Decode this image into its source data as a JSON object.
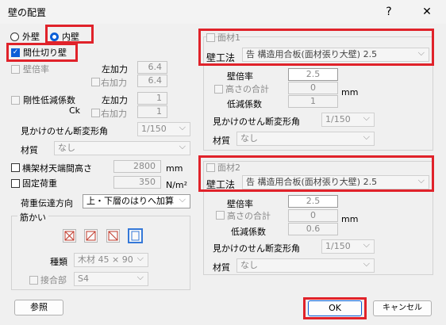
{
  "window": {
    "title": "壁の配置",
    "help": "?",
    "close": "✕"
  },
  "wall_type": {
    "outer": "外壁",
    "inner": "内壁",
    "partition": "間仕切り壁"
  },
  "left": {
    "ratio_label": "壁倍率",
    "left_add": "左加力",
    "right_add": "右加力",
    "ratio_left": "6.4",
    "ratio_right": "6.4",
    "stiff_label": "剛性低減係数",
    "ck": "Ck",
    "stiff_left": "1",
    "stiff_right": "1",
    "shear_angle_label": "見かけのせん断変形角",
    "shear_angle_value": "1/150",
    "material_label": "材質",
    "material_value": "なし",
    "beam_label": "横架材天端間高さ",
    "beam_value": "2800",
    "beam_unit": "mm",
    "fixed_load_label": "固定荷重",
    "fixed_load_value": "350",
    "fixed_load_unit": "N/m²",
    "load_dir_label": "荷重伝達方向",
    "load_dir_value": "上・下層のはりへ加算",
    "brace_group": "筋かい",
    "brace_type_label": "種類",
    "brace_type_value": "木材 45 × 90",
    "joint_label": "接合部",
    "joint_value": "S4"
  },
  "panels": [
    {
      "title": "面材1",
      "method_label": "壁工法",
      "method_value": "告 構造用合板(面材張り大壁) 2.5",
      "ratio_label": "壁倍率",
      "ratio_value": "2.5",
      "height_sum_label": "高さの合計",
      "height_sum_value": "0",
      "height_unit": "mm",
      "reduction_label": "低減係数",
      "reduction_value": "1",
      "angle_label": "見かけのせん断変形角",
      "angle_value": "1/150",
      "material_label": "材質",
      "material_value": "なし"
    },
    {
      "title": "面材2",
      "method_label": "壁工法",
      "method_value": "告 構造用合板(面材張り大壁) 2.5",
      "ratio_label": "壁倍率",
      "ratio_value": "2.5",
      "height_sum_label": "高さの合計",
      "height_sum_value": "0",
      "height_unit": "mm",
      "reduction_label": "低減係数",
      "reduction_value": "0.6",
      "angle_label": "見かけのせん断変形角",
      "angle_value": "1/150",
      "material_label": "材質",
      "material_value": "なし"
    }
  ],
  "buttons": {
    "ref": "参照",
    "ok": "OK",
    "cancel": "キャンセル"
  }
}
